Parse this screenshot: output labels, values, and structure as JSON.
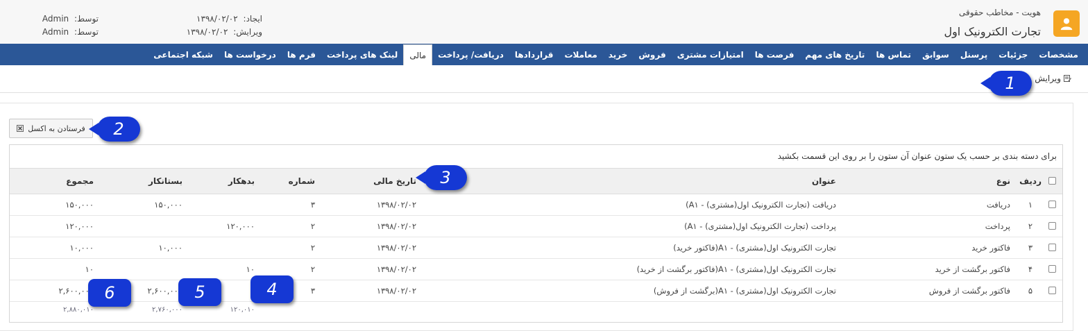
{
  "header": {
    "subtitle": "هویت -  مخاطب حقوقی",
    "title": "تجارت الکترونیک اول",
    "created_label": "ایجاد:",
    "created_value": "۱۳۹۸/۰۲/۰۲",
    "edited_label": "ویرایش:",
    "edited_value": "۱۳۹۸/۰۲/۰۲",
    "by_label": "توسط:",
    "by_value_1": "Admin",
    "by_value_2": "Admin",
    "logo_color": "#f5a623"
  },
  "nav": {
    "tabs": [
      "مشخصات",
      "جزئیات",
      "پرسنل",
      "سوابق",
      "تماس ها",
      "تاریخ های مهم",
      "فرصت ها",
      "امتیازات مشتری",
      "فروش",
      "خرید",
      "معاملات",
      "قراردادها",
      "دریافت/ پرداخت",
      "مالی",
      "لینک های پرداخت",
      "فرم ها",
      "درخواست ها",
      "شبکه اجتماعی"
    ],
    "active": "مالی",
    "color": "#2b5797"
  },
  "toolbar": {
    "edit_label": "ویرایش",
    "excel_label": "فرستادن به اکسل"
  },
  "grid": {
    "group_hint": "برای دسته بندی بر حسب یک ستون عنوان آن ستون را بر روی این قسمت بکشید",
    "headers": {
      "row": "ردیف",
      "type": "نوع",
      "title": "عنوان",
      "date": "تاریخ مالی",
      "number": "شماره",
      "debit": "بدهکار",
      "credit": "بستانکار",
      "total": "مجموع"
    },
    "rows": [
      {
        "row": "۱",
        "type": "دریافت",
        "title": "دریافت (تجارت الکترونیک اول(مشتری) - A۱)",
        "date": "۱۳۹۸/۰۲/۰۲",
        "number": "۳",
        "debit": "",
        "credit": "۱۵۰,۰۰۰",
        "total": "۱۵۰,۰۰۰"
      },
      {
        "row": "۲",
        "type": "پرداخت",
        "title": "پرداخت (تجارت الکترونیک اول(مشتری) - A۱)",
        "date": "۱۳۹۸/۰۲/۰۲",
        "number": "۲",
        "debit": "۱۲۰,۰۰۰",
        "credit": "",
        "total": "۱۲۰,۰۰۰"
      },
      {
        "row": "۳",
        "type": "فاکتور خرید",
        "title": "تجارت الکترونیک اول(مشتری) - A۱(فاکتور خرید)",
        "date": "۱۳۹۸/۰۲/۰۲",
        "number": "۲",
        "debit": "",
        "credit": "۱۰,۰۰۰",
        "total": "۱۰,۰۰۰"
      },
      {
        "row": "۴",
        "type": "فاکتور برگشت از خرید",
        "title": "تجارت الکترونیک اول(مشتری) - A۱(فاکتور برگشت از خرید)",
        "date": "۱۳۹۸/۰۲/۰۲",
        "number": "۲",
        "debit": "۱۰",
        "credit": "",
        "total": "۱۰"
      },
      {
        "row": "۵",
        "type": "فاکتور برگشت از فروش",
        "title": "تجارت الکترونیک اول(مشتری) - A۱(برگشت از فروش)",
        "date": "۱۳۹۸/۰۲/۰۲",
        "number": "۳",
        "debit": "",
        "credit": "۲,۶۰۰,۰۰۰",
        "total": "۲,۶۰۰,۰۰۰"
      }
    ],
    "totals": {
      "debit": "۱۲۰,۰۱۰",
      "credit": "۲,۷۶۰,۰۰۰",
      "total": "۲,۸۸۰,۰۱۰"
    }
  },
  "callouts": [
    "1",
    "2",
    "3",
    "4",
    "5",
    "6"
  ],
  "callout_color": "#1538d4"
}
